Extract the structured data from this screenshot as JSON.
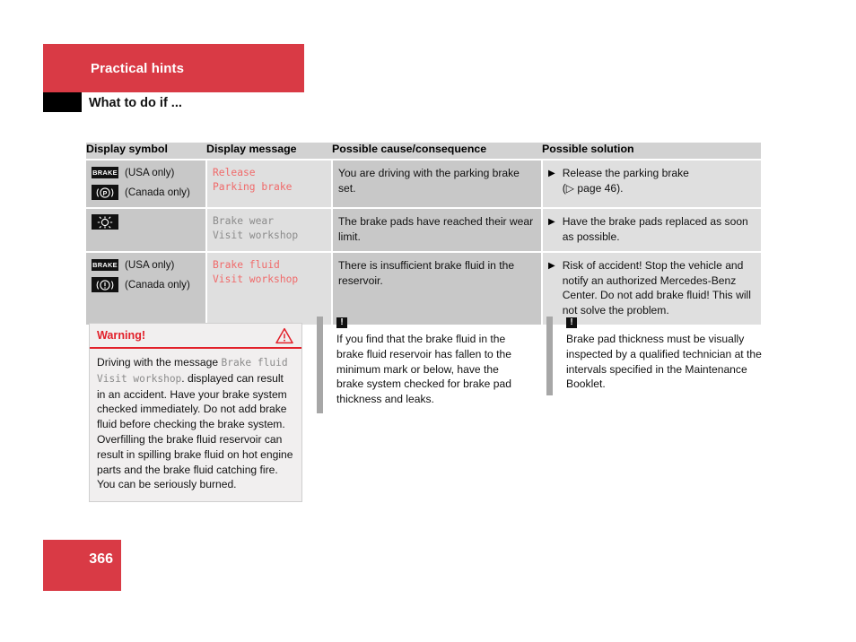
{
  "header": {
    "chapter": "Practical hints",
    "section": "What to do if ...",
    "bar_color": "#d93a45"
  },
  "table": {
    "columns": [
      "Display symbol",
      "Display message",
      "Possible cause/consequence",
      "Possible solution"
    ],
    "rows": [
      {
        "symbols": [
          {
            "icon": "brake-text-icon",
            "label": "BRAKE",
            "note": "(USA only)"
          },
          {
            "icon": "parking-brake-p-icon",
            "label": "P",
            "note": "(Canada only)"
          }
        ],
        "message": "Release\nParking brake",
        "message_color": "red",
        "cause": "You are driving with the parking brake set.",
        "solution": "Release the parking brake\n(▷ page 46).",
        "bullet": "▶"
      },
      {
        "symbols": [
          {
            "icon": "brake-wear-lamp-icon",
            "label": "",
            "note": ""
          }
        ],
        "message": "Brake wear\nVisit workshop",
        "message_color": "gray",
        "cause": "The brake pads have reached their wear limit.",
        "solution": "Have the brake pads replaced as soon as possible.",
        "bullet": "▶"
      },
      {
        "symbols": [
          {
            "icon": "brake-text-icon",
            "label": "BRAKE",
            "note": "(USA only)"
          },
          {
            "icon": "brake-fluid-warning-icon",
            "label": "!",
            "note": "(Canada only)"
          }
        ],
        "message": "Brake fluid\nVisit workshop",
        "message_color": "red",
        "cause": "There is insufficient brake fluid in the reservoir.",
        "solution": "Risk of accident! Stop the vehicle and notify an authorized Mercedes-Benz Center. Do not add brake fluid! This will not solve the problem.",
        "bullet": "▶"
      }
    ]
  },
  "warning": {
    "title": "Warning!",
    "icon": "warning-triangle-icon",
    "text_part1": "Driving with the message ",
    "text_mono": "Brake fluid Visit workshop",
    "text_part2": ". displayed can result in an accident. Have your brake system checked immediately. Do not add brake fluid before checking the brake system. Overfilling the brake fluid reservoir can result in spilling brake fluid on hot engine parts and the brake fluid catching fire. You can be seriously burned.",
    "accent_color": "#e2202a"
  },
  "notes": [
    {
      "icon": "exclamation-box-icon",
      "icon_char": "!",
      "text": "If you find that the brake fluid in the brake fluid reservoir has fallen to the minimum mark or below, have the brake system checked for brake pad thickness and leaks."
    },
    {
      "icon": "exclamation-box-icon",
      "icon_char": "!",
      "text": "Brake pad thickness must be visually inspected by a qualified technician at the intervals specified in the Maintenance Booklet."
    }
  ],
  "footer": {
    "page_number": "366"
  }
}
